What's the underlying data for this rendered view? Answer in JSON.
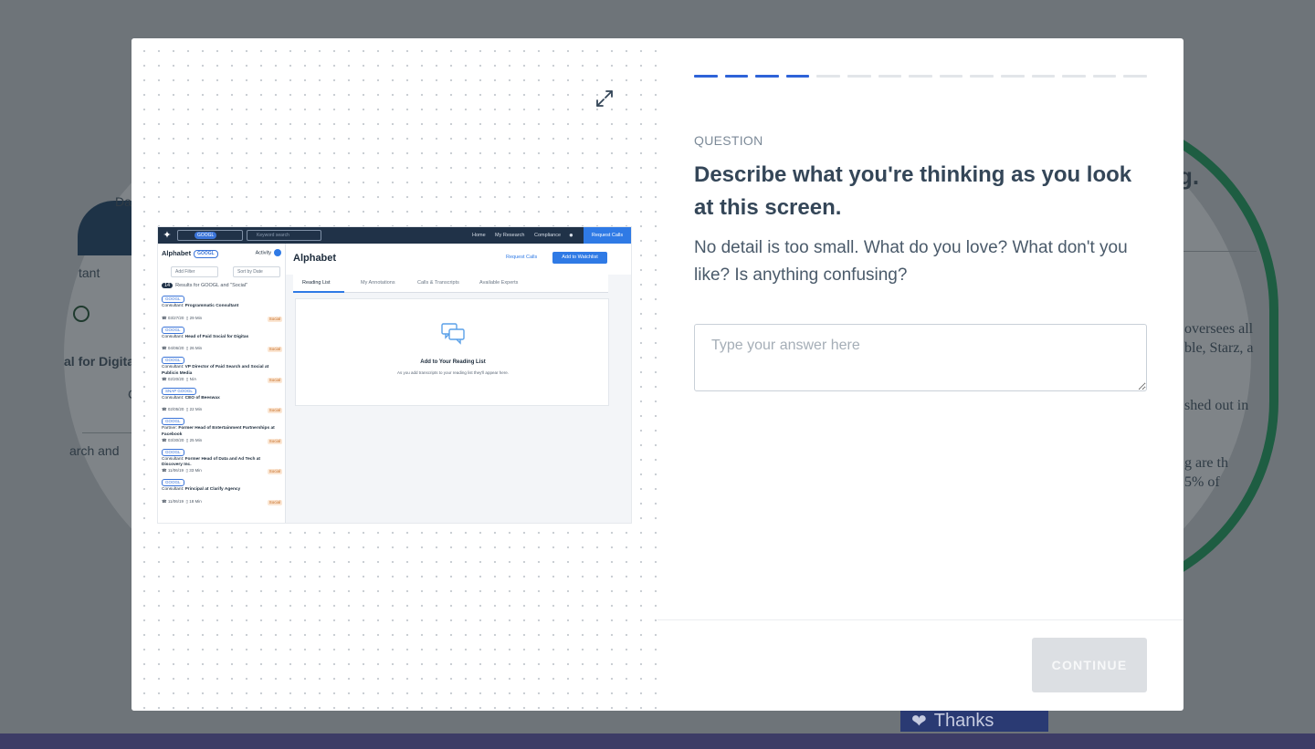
{
  "background": {
    "fragments": {
      "dat": "Dat",
      "tant": "tant",
      "al_digitas": "al for Digitas",
      "c_letter": "C",
      "arch_and": "arch and",
      "oversees": "oversees all",
      "ble_starz": "ble, Starz, a",
      "shed_out": "shed out in",
      "g_are": "g are th",
      "pct": "5% of",
      "g_head": "g."
    },
    "thanks_label": "Thanks"
  },
  "modal": {
    "progress": {
      "total": 15,
      "current": 4
    },
    "question_label": "QUESTION",
    "question_title": "Describe what you're thinking as you look at this screen.",
    "question_description": "No detail is too small. What do you love? What don't you like? Is anything confusing?",
    "answer_placeholder": "Type your answer here",
    "continue_label": "CONTINUE",
    "colors": {
      "accent": "#2e63d8",
      "title": "#344658",
      "muted": "#7c8a98"
    }
  },
  "screenshot": {
    "company_tag": "GOOGL",
    "search_placeholder": "Keyword search",
    "nav": [
      "Home",
      "My Research",
      "Compliance"
    ],
    "request_calls": "Request Calls",
    "sidebar": {
      "title": "Alphabet",
      "title_tag": "GOOGL",
      "activity": "Activity",
      "filter": "Add Filter",
      "sort": "Sort by Date",
      "results_count": "14",
      "results_text": "Results for GOOGL and \"Social\"",
      "items": [
        {
          "tag": "GOOGL",
          "role": "Consultant:",
          "name": "Programmatic Consultant",
          "date": "03/27/20",
          "duration": "29 Min",
          "badge": "Social"
        },
        {
          "tag": "GOOGL",
          "role": "Consultant:",
          "name": "Head of Paid Social for Digitas",
          "date": "04/06/20",
          "duration": "26 Min",
          "badge": "Social"
        },
        {
          "tag": "GOOGL",
          "role": "Consultant:",
          "name": "VP Director of Paid Search and Social at Publicis Media",
          "date": "02/20/20",
          "duration": "N/A",
          "badge": "Social"
        },
        {
          "tag": "SNAP  GOOGL",
          "role": "Consultant:",
          "name": "CEO of Beeswax",
          "date": "02/05/20",
          "duration": "22 Min",
          "badge": "Social"
        },
        {
          "tag": "GOOGL",
          "role": "Partner:",
          "name": "Former Head of Entertainment Partnerships at Facebook",
          "date": "03/30/20",
          "duration": "25 Min",
          "badge": "Social"
        },
        {
          "tag": "GOOGL",
          "role": "Consultant:",
          "name": "Former Head of Data and Ad Tech at Discovery Inc.",
          "date": "11/06/19",
          "duration": "33 Min",
          "badge": "Social"
        },
        {
          "tag": "GOOGL",
          "role": "Consultant:",
          "name": "Principal at Clarify Agency",
          "date": "11/06/19",
          "duration": "18 Min",
          "badge": "Social"
        }
      ]
    },
    "main": {
      "title": "Alphabet",
      "request_calls": "Request Calls",
      "add_watchlist": "Add to Watchlist",
      "tabs": [
        "Reading List",
        "My Annotations",
        "Calls & Transcripts",
        "Available Experts"
      ],
      "empty_title": "Add to Your Reading List",
      "empty_sub": "As you add transcripts to your reading list they'll appear here."
    }
  }
}
